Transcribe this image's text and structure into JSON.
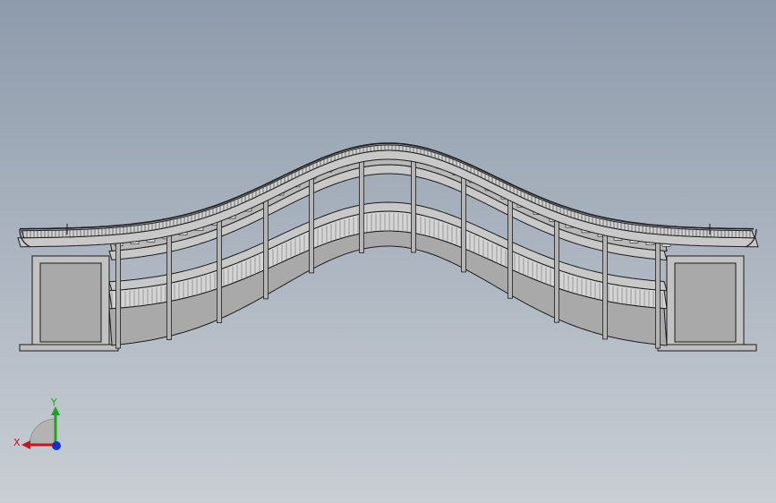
{
  "viewport": {
    "background_top": "#8e9bac",
    "background_bottom": "#c9ced4"
  },
  "model": {
    "view": "front",
    "line_color": "#1c1c1c",
    "fill_light": "#c8c8c8",
    "fill_mid": "#a9a9a9",
    "fill_dark": "#8d8d8d",
    "pillar_color": "#b5b5b5"
  },
  "triad": {
    "x_label": "X",
    "y_label": "Y",
    "x_color": "#d0101a",
    "y_color": "#1aa51a",
    "z_color": "#1030d0"
  }
}
